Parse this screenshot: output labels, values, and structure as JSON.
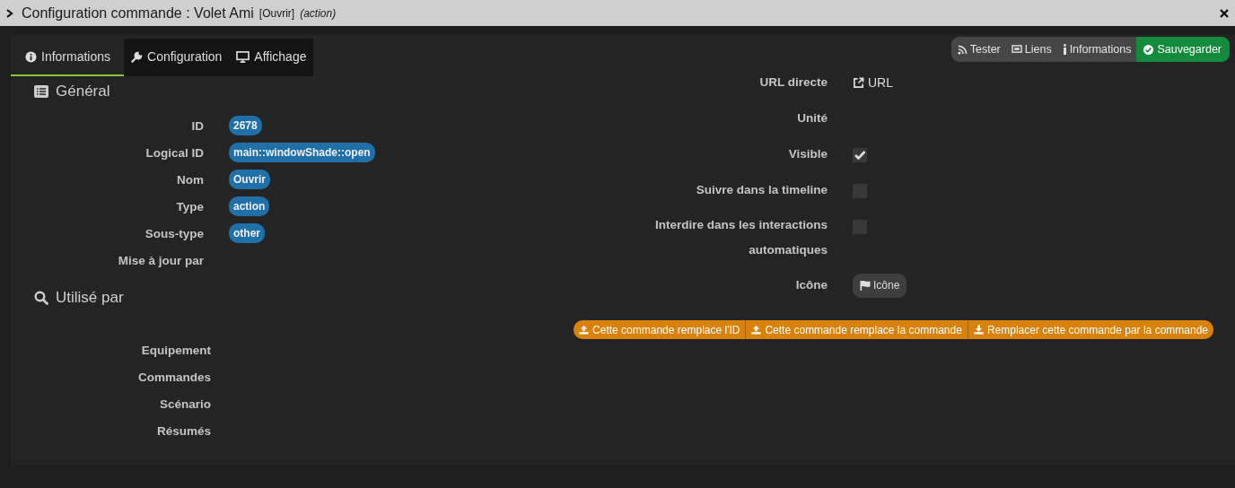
{
  "window": {
    "title": "Configuration commande : Volet Ami",
    "name_tag": "[Ouvrir]",
    "type_tag": "(action)"
  },
  "tabs": [
    {
      "label": "Informations",
      "selected": true
    },
    {
      "label": "Configuration",
      "selected": false
    },
    {
      "label": "Affichage",
      "selected": false
    }
  ],
  "toolbar": [
    {
      "label": "Tester",
      "kind": "plain"
    },
    {
      "label": "Liens",
      "kind": "plain"
    },
    {
      "label": "Informations",
      "kind": "plain"
    },
    {
      "label": "Sauvegarder",
      "kind": "primary"
    }
  ],
  "general": {
    "title": "Général",
    "rows": [
      {
        "label": "ID",
        "value": "2678"
      },
      {
        "label": "Logical ID",
        "value": "main::windowShade::open"
      },
      {
        "label": "Nom",
        "value": "Ouvrir"
      },
      {
        "label": "Type",
        "value": "action"
      },
      {
        "label": "Sous-type",
        "value": "other"
      },
      {
        "label": "Mise à jour par"
      }
    ]
  },
  "used_by": {
    "title": "Utilisé par",
    "rows": [
      {
        "label": "Equipement"
      },
      {
        "label": "Commandes"
      },
      {
        "label": "Scénario"
      },
      {
        "label": "Résumés"
      }
    ]
  },
  "settings": [
    {
      "label": "URL directe",
      "kind": "link",
      "value": "URL"
    },
    {
      "label": "Unité",
      "kind": "empty"
    },
    {
      "label": "Visible",
      "kind": "checkbox",
      "checked": true
    },
    {
      "label": "Suivre dans la timeline",
      "kind": "checkbox",
      "checked": false
    },
    {
      "label": "Interdire dans les interactions automatiques",
      "kind": "checkbox",
      "checked": false
    },
    {
      "label": "Icône",
      "kind": "button",
      "value": "Icône"
    }
  ],
  "actions": [
    {
      "label": "Cette commande remplace l'ID",
      "kind": "upload"
    },
    {
      "label": "Cette commande remplace la commande",
      "kind": "upload"
    },
    {
      "label": "Remplacer cette commande par la commande",
      "kind": "download"
    }
  ]
}
